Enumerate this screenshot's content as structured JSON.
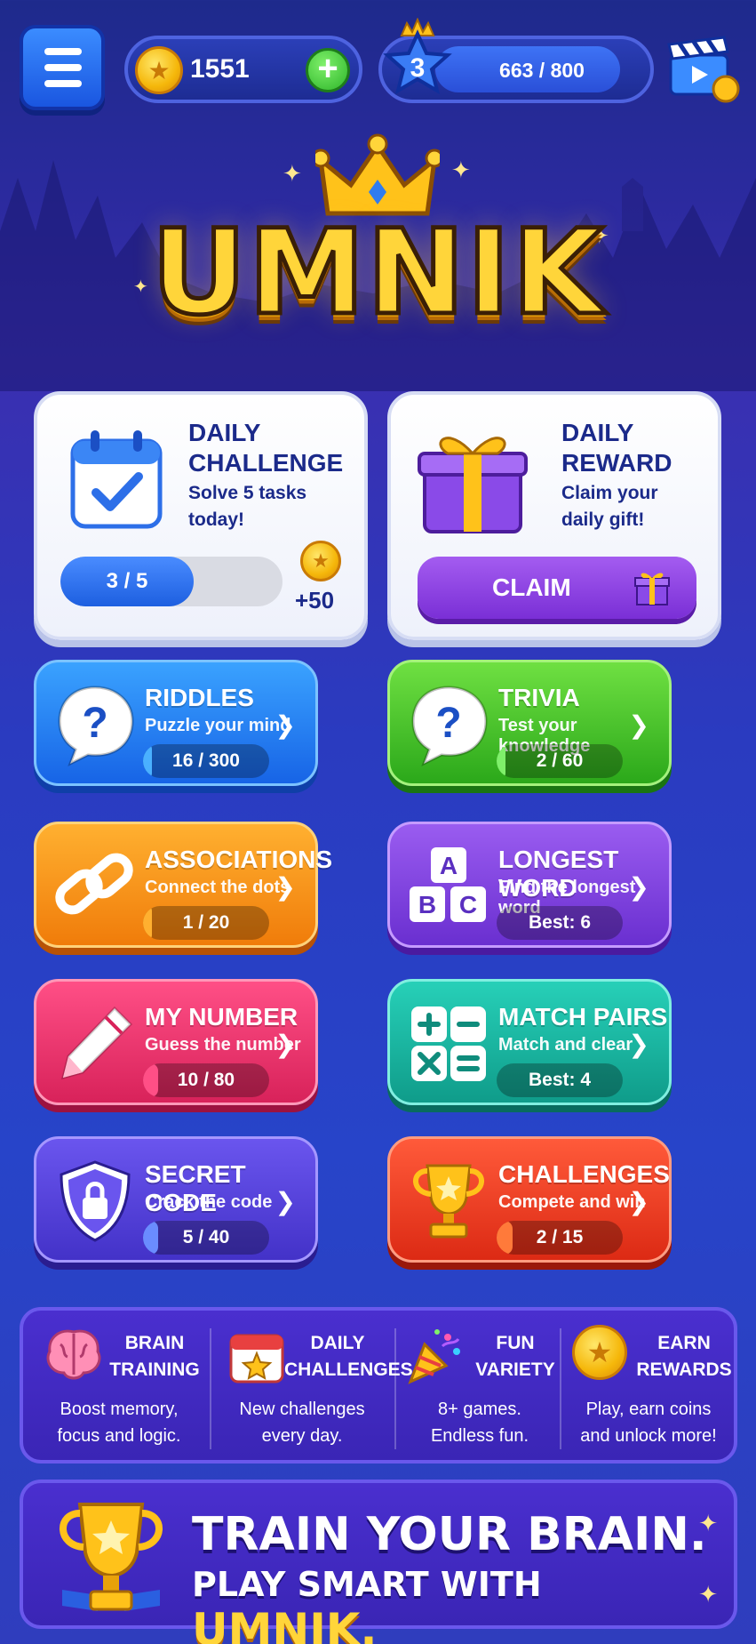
{
  "header": {
    "coins": "1551",
    "level": "3",
    "xp": "663 / 800",
    "xp_progress": 0.83
  },
  "logo": "UMNIK",
  "daily_challenge": {
    "title_line1": "DAILY",
    "title_line2": "CHALLENGE",
    "sub_line1": "Solve 5 tasks",
    "sub_line2": "today!",
    "progress": "3 / 5",
    "progress_fraction": 0.6,
    "reward": "+50"
  },
  "daily_reward": {
    "title_line1": "DAILY",
    "title_line2": "REWARD",
    "sub_line1": "Claim your",
    "sub_line2": "daily gift!",
    "button": "CLAIM"
  },
  "games": [
    {
      "title": "RIDDLES",
      "subtitle": "Puzzle your mind",
      "progress": "16 / 300",
      "fraction": 0.05,
      "icon": "question-bubble-icon"
    },
    {
      "title": "TRIVIA",
      "subtitle": "Test your knowledge",
      "progress": "2 / 60",
      "fraction": 0.03,
      "icon": "question-bubble-icon"
    },
    {
      "title": "ASSOCIATIONS",
      "subtitle": "Connect the dots",
      "progress": "1 / 20",
      "fraction": 0.05,
      "icon": "chain-link-icon"
    },
    {
      "title": "LONGEST WORD",
      "subtitle": "Find the longest word",
      "progress": "Best: 6",
      "fraction": 0,
      "icon": "abc-blocks-icon"
    },
    {
      "title": "MY NUMBER",
      "subtitle": "Guess the number",
      "progress": "10 / 80",
      "fraction": 0.12,
      "icon": "pencil-icon"
    },
    {
      "title": "MATCH PAIRS",
      "subtitle": "Match and clear",
      "progress": "Best: 4",
      "fraction": 0,
      "icon": "math-tiles-icon"
    },
    {
      "title": "SECRET CODE",
      "subtitle": "Crack the code",
      "progress": "5 / 40",
      "fraction": 0.12,
      "icon": "shield-lock-icon"
    },
    {
      "title": "CHALLENGES",
      "subtitle": "Compete and win",
      "progress": "2 / 15",
      "fraction": 0.13,
      "icon": "trophy-icon"
    }
  ],
  "features": [
    {
      "title_line1": "BRAIN",
      "title_line2": "TRAINING",
      "desc_line1": "Boost memory,",
      "desc_line2": "focus and logic.",
      "icon": "brain-icon"
    },
    {
      "title_line1": "DAILY",
      "title_line2": "CHALLENGES",
      "desc_line1": "New challenges",
      "desc_line2": "every day.",
      "icon": "calendar-star-icon"
    },
    {
      "title_line1": "FUN",
      "title_line2": "VARIETY",
      "desc_line1": "8+ games.",
      "desc_line2": "Endless fun.",
      "icon": "party-popper-icon"
    },
    {
      "title_line1": "EARN",
      "title_line2": "REWARDS",
      "desc_line1": "Play, earn coins",
      "desc_line2": "and unlock more!",
      "icon": "coin-icon"
    }
  ],
  "banner": {
    "line1": "TRAIN YOUR BRAIN.",
    "line2_prefix": "PLAY SMART WITH ",
    "line2_brand": "UMNIK."
  }
}
